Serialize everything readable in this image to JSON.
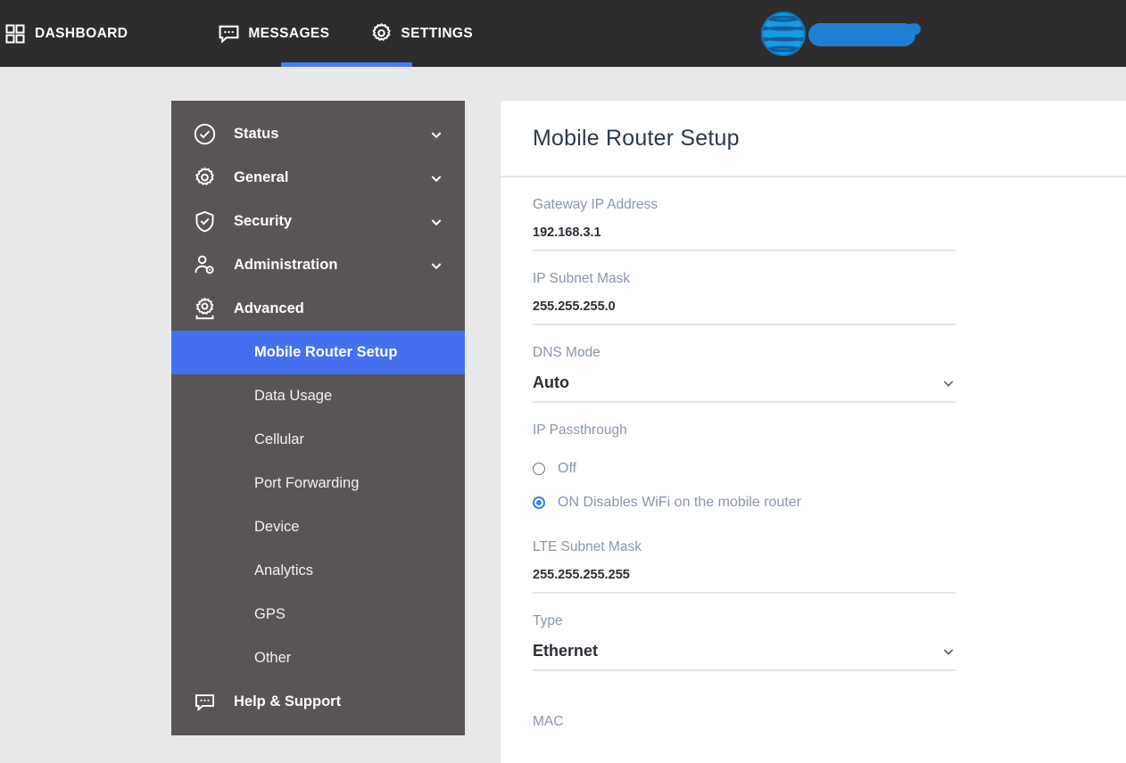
{
  "topnav": {
    "items": [
      {
        "label": "DASHBOARD",
        "icon": "dashboard-grid-icon",
        "active": false
      },
      {
        "label": "MESSAGES",
        "icon": "message-bubble-icon",
        "active": false
      },
      {
        "label": "SETTINGS",
        "icon": "gear-icon",
        "active": true
      }
    ],
    "active_indicator_color": "#4a7bf7",
    "background_color": "#2d2d2d",
    "logo": {
      "name": "att-globe-logo",
      "colors": [
        "#0b84d6",
        "#1a9ae0",
        "#0568ad"
      ],
      "redaction_color": "#1e7fd4"
    }
  },
  "sidebar": {
    "background_color": "#585554",
    "selected_color": "#4470f0",
    "groups": [
      {
        "label": "Status",
        "icon": "check-circle-icon",
        "expandable": true,
        "expanded": false
      },
      {
        "label": "General",
        "icon": "gear-icon",
        "expandable": true,
        "expanded": false
      },
      {
        "label": "Security",
        "icon": "shield-check-icon",
        "expandable": true,
        "expanded": false
      },
      {
        "label": "Administration",
        "icon": "user-settings-icon",
        "expandable": true,
        "expanded": false
      },
      {
        "label": "Advanced",
        "icon": "gear-advanced-icon",
        "expandable": false,
        "expanded": true
      }
    ],
    "advanced_items": [
      {
        "label": "Mobile Router Setup",
        "selected": true
      },
      {
        "label": "Data Usage",
        "selected": false
      },
      {
        "label": "Cellular",
        "selected": false
      },
      {
        "label": "Port Forwarding",
        "selected": false
      },
      {
        "label": "Device",
        "selected": false
      },
      {
        "label": "Analytics",
        "selected": false
      },
      {
        "label": "GPS",
        "selected": false
      },
      {
        "label": "Other",
        "selected": false
      }
    ],
    "footer": {
      "label": "Help & Support",
      "icon": "message-bubble-icon"
    }
  },
  "content": {
    "title": "Mobile Router Setup",
    "fields": {
      "gateway_ip": {
        "label": "Gateway IP Address",
        "value": "192.168.3.1"
      },
      "ip_subnet_mask": {
        "label": "IP Subnet Mask",
        "value": "255.255.255.0"
      },
      "dns_mode": {
        "label": "DNS Mode",
        "value": "Auto",
        "control": "dropdown"
      },
      "ip_passthrough": {
        "label": "IP Passthrough",
        "options": [
          {
            "label": "Off",
            "selected": false
          },
          {
            "label": "ON Disables WiFi on the mobile router",
            "selected": true
          }
        ]
      },
      "lte_subnet_mask": {
        "label": "LTE Subnet Mask",
        "value": "255.255.255.255"
      },
      "type": {
        "label": "Type",
        "value": "Ethernet",
        "control": "dropdown"
      },
      "mac": {
        "label": "MAC",
        "value": ""
      }
    }
  }
}
